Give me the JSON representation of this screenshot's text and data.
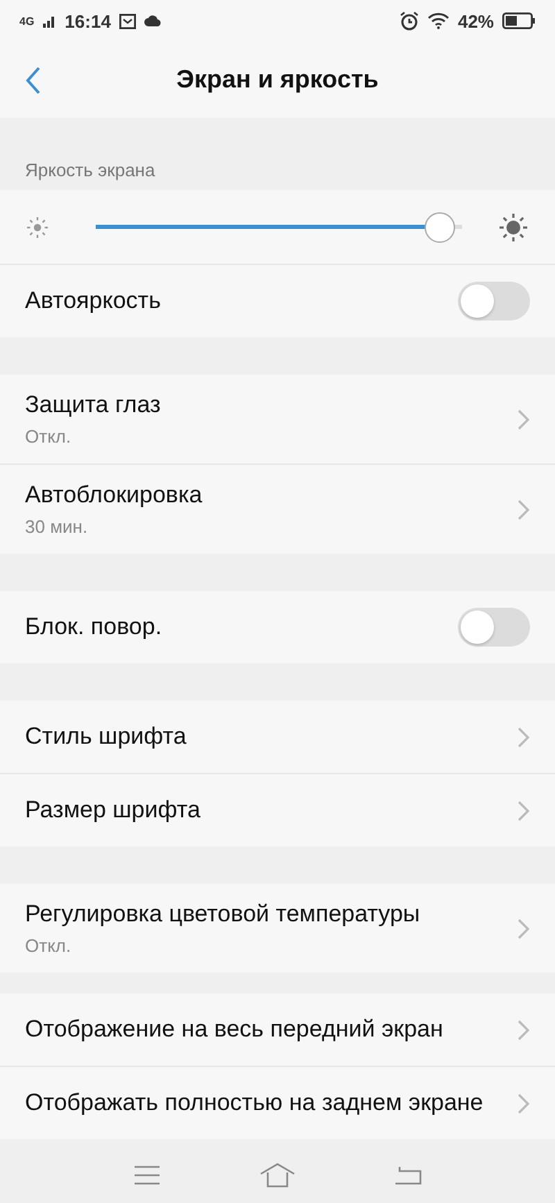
{
  "status_bar": {
    "network": "4G",
    "time": "16:14",
    "battery": "42%"
  },
  "header": {
    "title": "Экран и яркость"
  },
  "groups": [
    {
      "label": "Яркость экрана",
      "items": [
        {
          "kind": "slider",
          "level": 0.94
        },
        {
          "kind": "toggle",
          "label": "Автояркость",
          "on": false
        }
      ]
    },
    {
      "items": [
        {
          "kind": "link",
          "label": "Защита глаз",
          "value": "Откл."
        },
        {
          "kind": "link",
          "label": "Автоблокировка",
          "value": "30 мин."
        }
      ]
    },
    {
      "items": [
        {
          "kind": "toggle",
          "label": "Блок. повор.",
          "on": false
        }
      ]
    },
    {
      "items": [
        {
          "kind": "link",
          "label": "Стиль шрифта"
        },
        {
          "kind": "link",
          "label": "Размер шрифта"
        }
      ]
    },
    {
      "items": [
        {
          "kind": "link",
          "label": "Регулировка цветовой температуры",
          "value": "Откл."
        }
      ]
    },
    {
      "items": [
        {
          "kind": "link",
          "label": "Отображение на весь передний экран"
        },
        {
          "kind": "link",
          "label": "Отображать полностью на заднем экране"
        }
      ]
    }
  ]
}
